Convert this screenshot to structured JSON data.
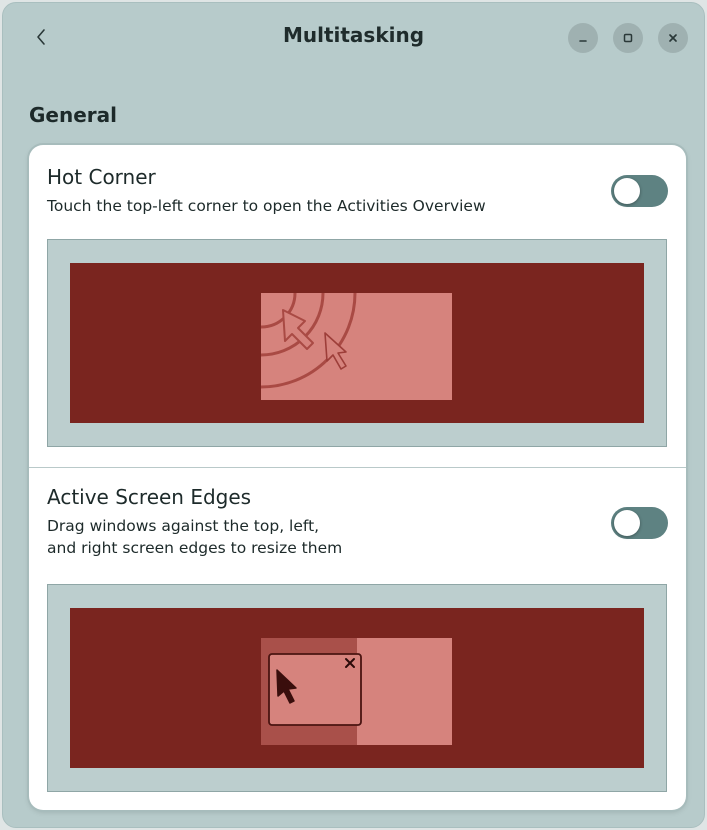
{
  "header": {
    "title": "Multitasking",
    "back_icon": "chevron-left-icon",
    "buttons": {
      "minimize_icon": "minimize-icon",
      "maximize_icon": "maximize-icon",
      "close_icon": "close-icon"
    }
  },
  "general": {
    "title": "General",
    "hot_corner": {
      "title": "Hot Corner",
      "subtitle": "Touch the top-left corner to open the Activities Overview",
      "enabled": false
    },
    "active_screen_edges": {
      "title": "Active Screen Edges",
      "subtitle_line1": "Drag windows against the top, left,",
      "subtitle_line2": "and right screen edges to resize them",
      "enabled": false
    }
  },
  "colors": {
    "window_bg": "#b7cbcb",
    "card_bg": "#ffffff",
    "switch_off": "#5e8282",
    "desktop": "#7a251f",
    "window_preview": "#d6837d"
  }
}
